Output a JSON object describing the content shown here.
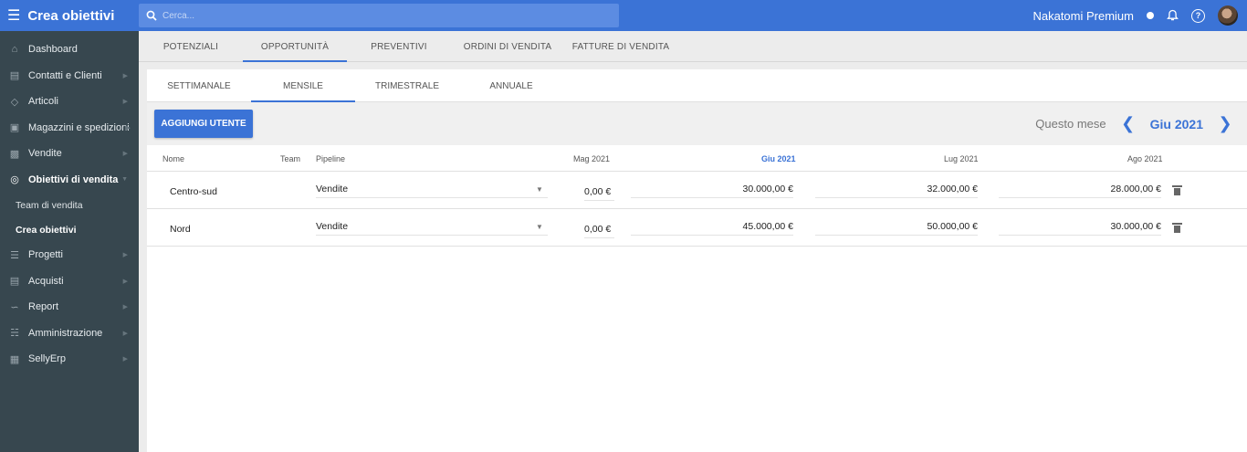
{
  "app": {
    "title": "Crea obiettivi"
  },
  "search": {
    "placeholder": "Cerca..."
  },
  "account": {
    "name": "Nakatomi Premium"
  },
  "sidebar": {
    "items": [
      {
        "label": "Dashboard",
        "icon": "home-icon"
      },
      {
        "label": "Contatti e Clienti",
        "icon": "contacts-icon"
      },
      {
        "label": "Articoli",
        "icon": "tag-icon"
      },
      {
        "label": "Magazzini e spedizioni",
        "icon": "truck-icon"
      },
      {
        "label": "Vendite",
        "icon": "register-icon"
      },
      {
        "label": "Obiettivi di vendita",
        "icon": "target-icon"
      },
      {
        "label": "Progetti",
        "icon": "projects-icon"
      },
      {
        "label": "Acquisti",
        "icon": "document-icon"
      },
      {
        "label": "Report",
        "icon": "chart-icon"
      },
      {
        "label": "Amministrazione",
        "icon": "bank-icon"
      },
      {
        "label": "SellyErp",
        "icon": "building-icon"
      }
    ],
    "subitems": [
      {
        "label": "Team di vendita"
      },
      {
        "label": "Crea obiettivi"
      }
    ]
  },
  "main_tabs": [
    "POTENZIALI",
    "OPPORTUNITÀ",
    "PREVENTIVI",
    "ORDINI DI VENDITA",
    "FATTURE DI VENDITA"
  ],
  "sub_tabs": [
    "SETTIMANALE",
    "MENSILE",
    "TRIMESTRALE",
    "ANNUALE"
  ],
  "toolbar": {
    "add_user_label": "AGGIUNGI UTENTE",
    "period_label": "Questo mese",
    "period_value": "Giu 2021"
  },
  "table": {
    "headers": {
      "nome": "Nome",
      "team": "Team",
      "pipeline": "Pipeline",
      "m1": "Mag 2021",
      "m2": "Giu 2021",
      "m3": "Lug 2021",
      "m4": "Ago 2021"
    },
    "rows": [
      {
        "nome": "Centro-sud",
        "pipeline": "Vendite",
        "m1": "0,00 €",
        "m2": "30.000,00 €",
        "m3": "32.000,00 €",
        "m4": "28.000,00 €"
      },
      {
        "nome": "Nord",
        "pipeline": "Vendite",
        "m1": "0,00 €",
        "m2": "45.000,00 €",
        "m3": "50.000,00 €",
        "m4": "30.000,00 €"
      }
    ]
  },
  "colors": {
    "primary": "#3b73d6",
    "sidebar": "#37474f"
  }
}
